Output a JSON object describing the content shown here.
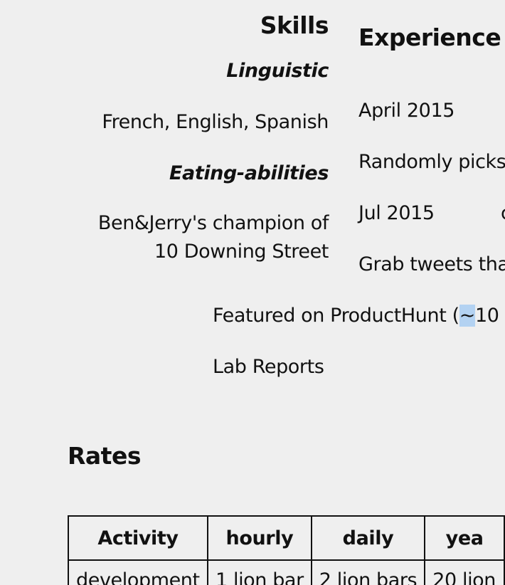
{
  "skills": {
    "heading": "Skills",
    "linguistic_label": "Linguistic",
    "linguistic_value": "French, English, Spanish",
    "eating_label": "Eating-abilities",
    "eating_value_line1": "Ben&Jerry's champion of",
    "eating_value_line2": "10 Downing Street"
  },
  "experience": {
    "heading": "Experience",
    "entries": [
      {
        "date": "April 2015",
        "desc": "Randomly picks"
      },
      {
        "date": "Jul 2015",
        "extra": "c",
        "desc": "Grab tweets tha"
      }
    ],
    "featured_prefix": "Featured on ProductHunt (",
    "featured_highlight": "~",
    "featured_suffix": "10",
    "lab_reports": "Lab Reports"
  },
  "rates": {
    "heading": "Rates",
    "columns": [
      "Activity",
      "hourly",
      "daily",
      "yea"
    ],
    "rows": [
      [
        "development",
        "1 lion bar",
        "2 lion bars",
        "20 lion"
      ]
    ]
  }
}
